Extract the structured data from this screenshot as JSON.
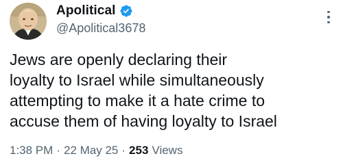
{
  "author": {
    "display_name": "Apolitical",
    "handle": "@Apolitical3678",
    "verified": true,
    "verified_color": "#1d9bf0"
  },
  "tweet": {
    "text": "Jews are openly declaring their\nloyalty to Israel while simultaneously\nattempting to make it a hate crime to\naccuse them of having loyalty to Israel"
  },
  "meta": {
    "time": "1:38 PM",
    "separator": "·",
    "date": "22 May 25",
    "views_count": "253",
    "views_label": "Views"
  },
  "icons": {
    "avatar": "portrait-avatar",
    "verified": "verified-badge-icon",
    "more": "more-options-icon"
  },
  "colors": {
    "text_primary": "#0f1419",
    "text_secondary": "#536471",
    "background": "#ffffff"
  }
}
